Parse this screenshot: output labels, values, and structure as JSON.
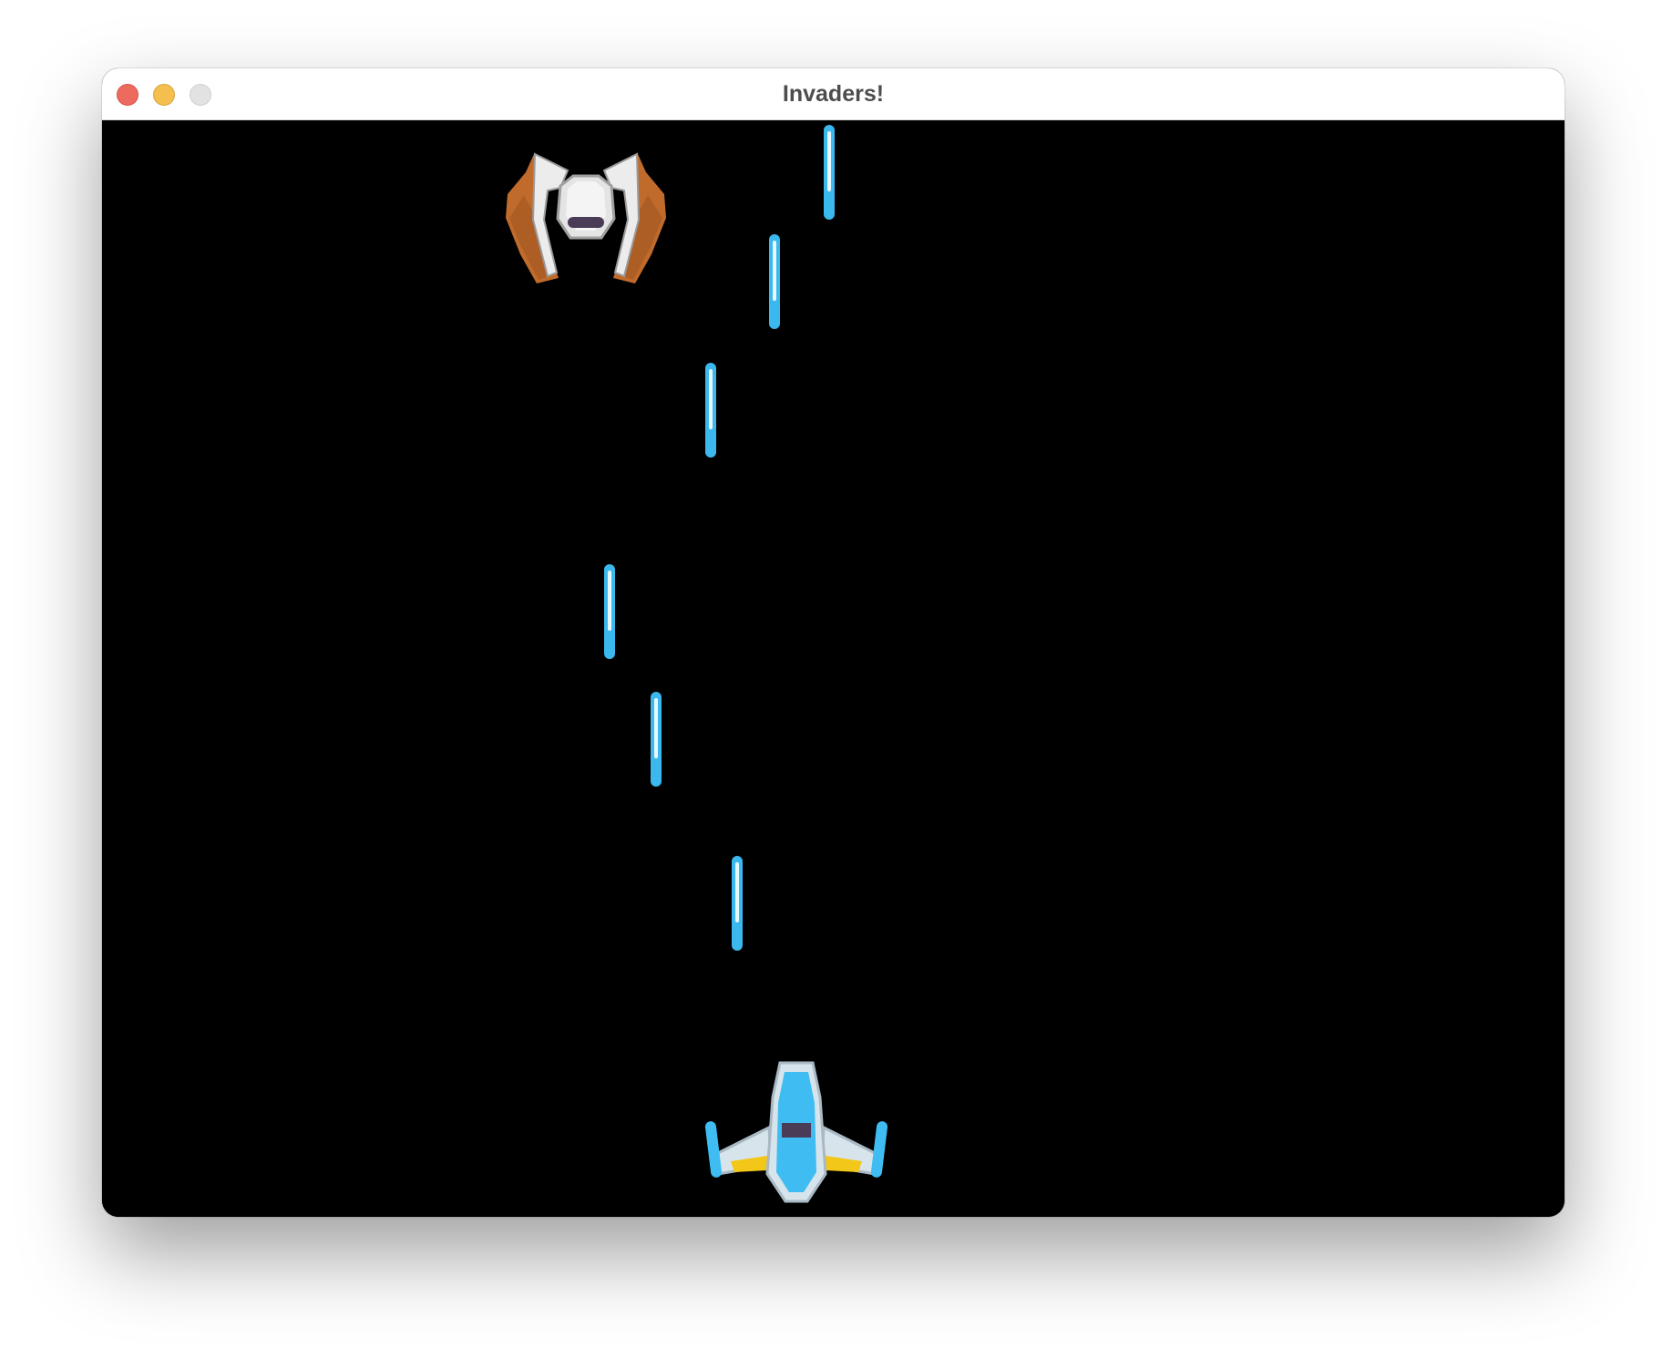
{
  "window": {
    "title": "Invaders!"
  },
  "colors": {
    "background": "#000000",
    "laser": "#3bb8ee",
    "laser_core": "#e8f8ff",
    "player_body": "#3fbdf2",
    "player_wing": "#d8e4ec",
    "player_trim": "#f2c718",
    "enemy_wing": "#c06b2c",
    "enemy_body": "#e8e8e8",
    "enemy_visor": "#4a3c56"
  },
  "icons": {
    "player": "player-ship-icon",
    "enemy": "enemy-ship-icon",
    "projectile": "laser-bolt-icon"
  }
}
